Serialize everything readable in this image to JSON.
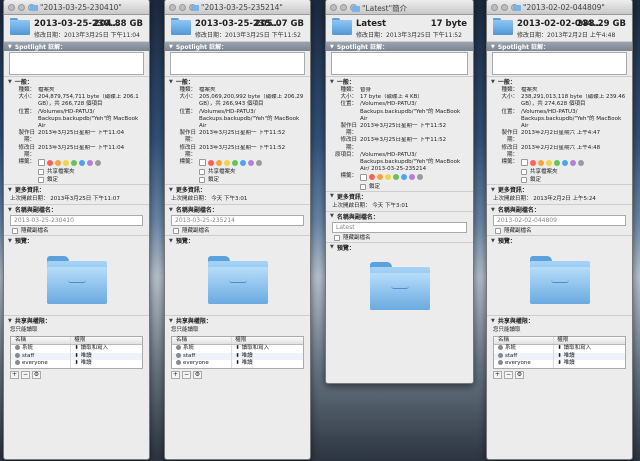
{
  "labels": {
    "spotlight": "Spotlight 註解：",
    "general": "一般：",
    "kind": "種類：",
    "size": "大小：",
    "where": "位置：",
    "created": "製作日期：",
    "modified": "修改日期：",
    "tags": "標籤：",
    "shared": "共享檔案夾",
    "locked": "鎖定",
    "more": "更多資訊：",
    "last_opened": "上次開啟日期：",
    "name_ext": "名稱與副檔名：",
    "hide_ext": "隱藏副檔名",
    "preview": "預覽：",
    "sharing": "共享與權限：",
    "can_read": "您只能讀取",
    "col_name": "名稱",
    "col_priv": "權限",
    "original": "原項目：",
    "mod_prefix": "修改日期：",
    "stamp_label": "標籤："
  },
  "windows": [
    {
      "title": "\"2013-03-25-230410\"",
      "name": "2013-03-25-230...",
      "size": "204.88 GB",
      "mod": "修改日期：2013年3月25日 下午11:04",
      "kind": "檔案夾",
      "size_full": "204,879,754,711 byte（磁碟上 206.1 GB），共 266,728 個項目",
      "where": "/Volumes/HD-PATU3/ Backups.backupdb/\"Yeh\"的 MacBook Air",
      "created": "2013年3月25日星期一 下午11:04",
      "modified": "2013年3月25日星期一 下午11:04",
      "last_opened": "2013年3月25日 下午11:07",
      "name_field": "2013-03-25-230410",
      "users": [
        {
          "name": "系統",
          "priv": "讀取和寫入"
        },
        {
          "name": "staff",
          "priv": "唯讀"
        },
        {
          "name": "everyone",
          "priv": "唯讀"
        }
      ]
    },
    {
      "title": "\"2013-03-25-235214\"",
      "name": "2013-03-25-235...",
      "size": "205.07 GB",
      "mod": "修改日期：2013年3月25日 下午11:52",
      "kind": "檔案夾",
      "size_full": "205,069,200,992 byte（磁碟上 206.29 GB），共 266,943 個項目",
      "where": "/Volumes/HD-PATU3/ Backups.backupdb/\"Yeh\"的 MacBook Air",
      "created": "2013年3月25日星期一 下午11:52",
      "modified": "2013年3月25日星期一 下午11:52",
      "last_opened": "今天 下午3:01",
      "name_field": "2013-03-25-235214",
      "users": [
        {
          "name": "系統",
          "priv": "讀取和寫入"
        },
        {
          "name": "staff",
          "priv": "唯讀"
        },
        {
          "name": "everyone",
          "priv": "唯讀"
        }
      ]
    },
    {
      "title": "\"Latest\"簡介",
      "name": "Latest",
      "size": "17 byte",
      "mod": "修改日期：2013年3月25日 下午11:52",
      "kind": "替身",
      "size_full": "17 byte（磁碟上 4 KB）",
      "where": "/Volumes/HD-PATU3/ Backups.backupdb/\"Yeh\"的 MacBook Air",
      "created": "2013年3月25日星期一 下午11:52",
      "modified": "2013年3月25日星期一 下午11:52",
      "original": "/Volumes/HD-PATU3/ Backups.backupdb/\"Yeh\"的 MacBook Air/ 2013-03-25-235214",
      "last_opened": "今天 下午3:01",
      "name_field": "Latest"
    },
    {
      "title": "\"2013-02-02-044809\"",
      "name": "2013-02-02-044...",
      "size": "238.29 GB",
      "mod": "修改日期：2013年2月2日 上午4:48",
      "kind": "檔案夾",
      "size_full": "238,291,013,118 byte（磁碟上 239.46 GB），共 274,628 個項目",
      "where": "/Volumes/HD-PATU3/ Backups.backupdb/\"Yeh\"的 MacBook Air",
      "created": "2013年2月2日星期六 上午4:47",
      "modified": "2013年2月2日星期六 上午4:48",
      "last_opened": "2013年2月2日 上午5:24",
      "name_field": "2013-02-02-044809",
      "users": [
        {
          "name": "系統",
          "priv": "讀取和寫入"
        },
        {
          "name": "staff",
          "priv": "唯讀"
        },
        {
          "name": "everyone",
          "priv": "唯讀"
        }
      ]
    }
  ],
  "tag_colors": [
    "#ff5f57",
    "#f7a33c",
    "#f5d443",
    "#69c354",
    "#4ea1f3",
    "#b77ed9",
    "#9b9b9b"
  ]
}
